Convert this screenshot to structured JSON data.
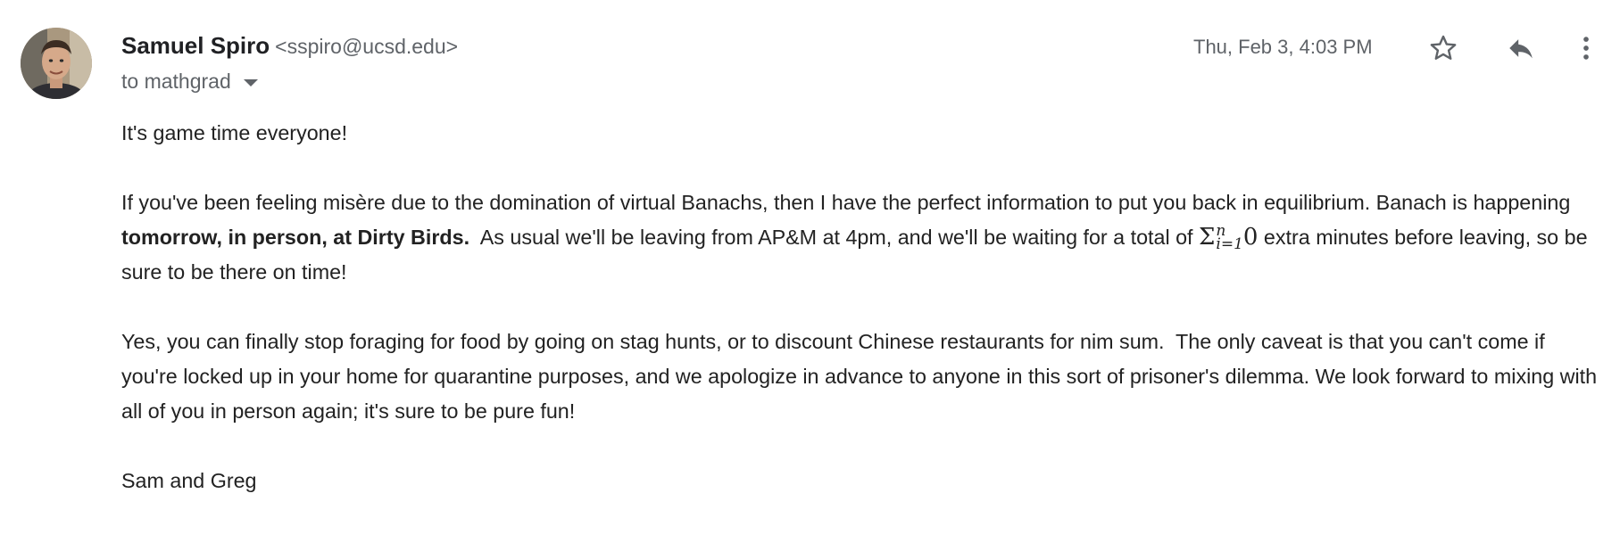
{
  "sender": {
    "name": "Samuel Spiro",
    "email": "<sspiro@ucsd.edu>",
    "to": "to mathgrad",
    "date": "Thu, Feb 3, 4:03 PM"
  },
  "icons": {
    "star": "star-outline-icon",
    "reply": "reply-icon",
    "more": "more-vertical-icon",
    "to_caret": "caret-down-icon"
  },
  "body": {
    "p1": "It's game time everyone!",
    "p2_a": "If you've been feeling misère due to the domination of virtual Banachs, then I have the perfect information to put you back in equilibrium. Banach is happening ",
    "p2_bold": "tomorrow, in person, at Dirty Birds.",
    "p2_b": "  As usual we'll be leaving from AP&M at 4pm, and we'll be waiting for a total of ",
    "math_sigma": "Σ",
    "math_upper": "n",
    "math_lower": "i=1",
    "math_zero": "0",
    "p2_c": " extra minutes before leaving, so be sure to be there on time!",
    "p3": "Yes, you can finally stop foraging for food by going on stag hunts, or to discount Chinese restaurants for nim sum.  The only caveat is that you can't come if you're locked up in your home for quarantine purposes, and we apologize in advance to anyone in this sort of prisoner's dilemma. We look forward to mixing with all of you in person again; it's sure to be pure fun!",
    "signature": "Sam and Greg"
  }
}
